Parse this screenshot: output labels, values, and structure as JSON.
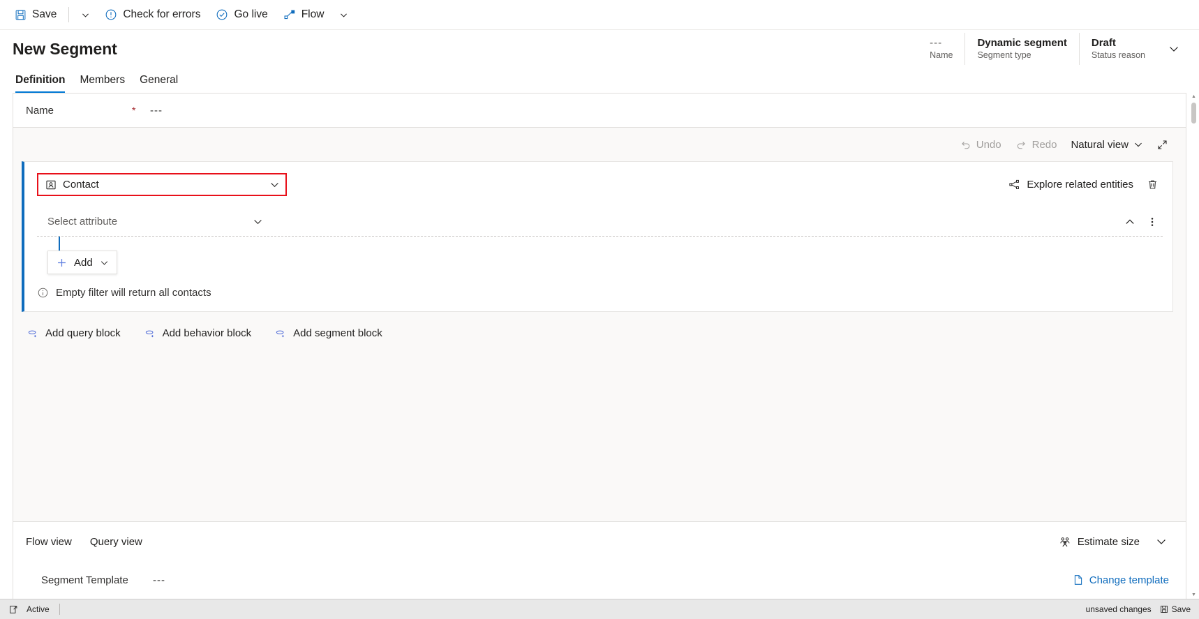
{
  "commandbar": {
    "save": {
      "label": "Save",
      "icon": "save-icon"
    },
    "save_chevron": "chevron-down-icon",
    "check_errors": {
      "label": "Check for errors",
      "icon": "error-circle-icon"
    },
    "go_live": {
      "label": "Go live",
      "icon": "check-circle-icon"
    },
    "flow": {
      "label": "Flow",
      "icon": "flow-icon"
    },
    "flow_chevron": "chevron-down-icon"
  },
  "header": {
    "title": "New Segment",
    "fields": [
      {
        "value": "---",
        "label": "Name",
        "muted": true
      },
      {
        "value": "Dynamic segment",
        "label": "Segment type",
        "muted": false
      },
      {
        "value": "Draft",
        "label": "Status reason",
        "muted": false
      }
    ],
    "expand_icon": "chevron-down-icon"
  },
  "tabs": [
    {
      "label": "Definition",
      "active": true
    },
    {
      "label": "Members",
      "active": false
    },
    {
      "label": "General",
      "active": false
    }
  ],
  "name_row": {
    "label": "Name",
    "required_marker": "*",
    "value": "---"
  },
  "canvas_toolbar": {
    "undo": {
      "label": "Undo",
      "icon": "undo-icon",
      "disabled": true
    },
    "redo": {
      "label": "Redo",
      "icon": "redo-icon",
      "disabled": true
    },
    "view_mode": {
      "label": "Natural view",
      "chevron": "chevron-down-icon"
    },
    "expand": "expand-diagonal-icon"
  },
  "query_block": {
    "entity": {
      "value": "Contact",
      "icon": "contact-entity-icon",
      "chevron": "chevron-down-icon",
      "highlight_color": "#e8101a"
    },
    "explore": {
      "label": "Explore related entities",
      "icon": "share-nodes-icon"
    },
    "delete_icon": "trash-icon",
    "attribute": {
      "placeholder": "Select attribute",
      "chevron": "chevron-down-icon"
    },
    "collapse_icon": "chevron-up-icon",
    "more_icon": "more-vertical-icon",
    "add_button": {
      "label": "Add",
      "plus_icon": "plus-icon",
      "chevron": "chevron-down-icon"
    },
    "hint": {
      "text": "Empty filter will return all contacts",
      "icon": "info-circle-icon"
    },
    "accent_color": "#0f6cbd"
  },
  "add_blocks": [
    {
      "label": "Add query block",
      "icon": "add-query-icon"
    },
    {
      "label": "Add behavior block",
      "icon": "add-behavior-icon"
    },
    {
      "label": "Add segment block",
      "icon": "add-segment-icon"
    }
  ],
  "bottom": {
    "view_tabs": [
      {
        "label": "Flow view"
      },
      {
        "label": "Query view"
      }
    ],
    "estimate": {
      "label": "Estimate size",
      "icon": "people-icon"
    },
    "estimate_chevron": "chevron-down-icon",
    "template": {
      "label": "Segment Template",
      "value": "---",
      "change_label": "Change template",
      "change_icon": "document-icon"
    }
  },
  "statusbar": {
    "state_icon": "popout-icon",
    "state_text": "Active",
    "unsaved_text": "unsaved changes",
    "save_label": "Save",
    "save_icon": "save-icon"
  }
}
